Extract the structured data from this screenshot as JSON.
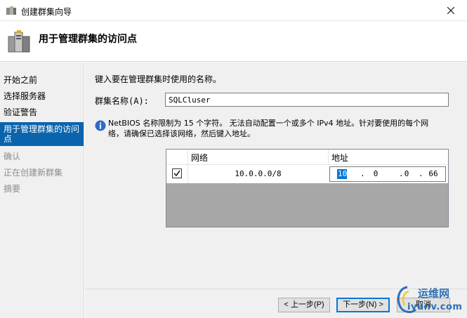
{
  "window": {
    "title": "创建群集向导"
  },
  "header": {
    "title": "用于管理群集的访问点"
  },
  "sidebar": {
    "steps": [
      {
        "label": "开始之前",
        "state": "done"
      },
      {
        "label": "选择服务器",
        "state": "done"
      },
      {
        "label": "验证警告",
        "state": "done"
      },
      {
        "label": "用于管理群集的访问点",
        "state": "active"
      },
      {
        "label": "确认",
        "state": "disabled"
      },
      {
        "label": "正在创建新群集",
        "state": "disabled"
      },
      {
        "label": "摘要",
        "state": "disabled"
      }
    ]
  },
  "main": {
    "intro": "键入要在管理群集时使用的名称。",
    "name_label": "群集名称(A):",
    "name_value": "SQLCluser",
    "info_line1": "NetBIOS 名称限制为 15 个字符。 无法自动配置一个或多个 IPv4 地址。针对要使用的每个网",
    "info_line2": "络，请确保已选择该网络，然后键入地址。",
    "grid": {
      "col_network": "网络",
      "col_address": "地址",
      "rows": [
        {
          "checked": true,
          "network": "10.0.0.0/8",
          "octets": [
            "10",
            "0",
            "0",
            "66"
          ]
        }
      ]
    }
  },
  "footer": {
    "back_label": "< 上一步(P)",
    "next_label": "下一步(N) >",
    "cancel_label": "取消"
  },
  "watermark": {
    "line1": "运维网",
    "line2": "iyunv.com"
  },
  "colors": {
    "accent": "#0a64ad",
    "selection": "#0078d7",
    "grid_empty": "#a7a7a7"
  }
}
